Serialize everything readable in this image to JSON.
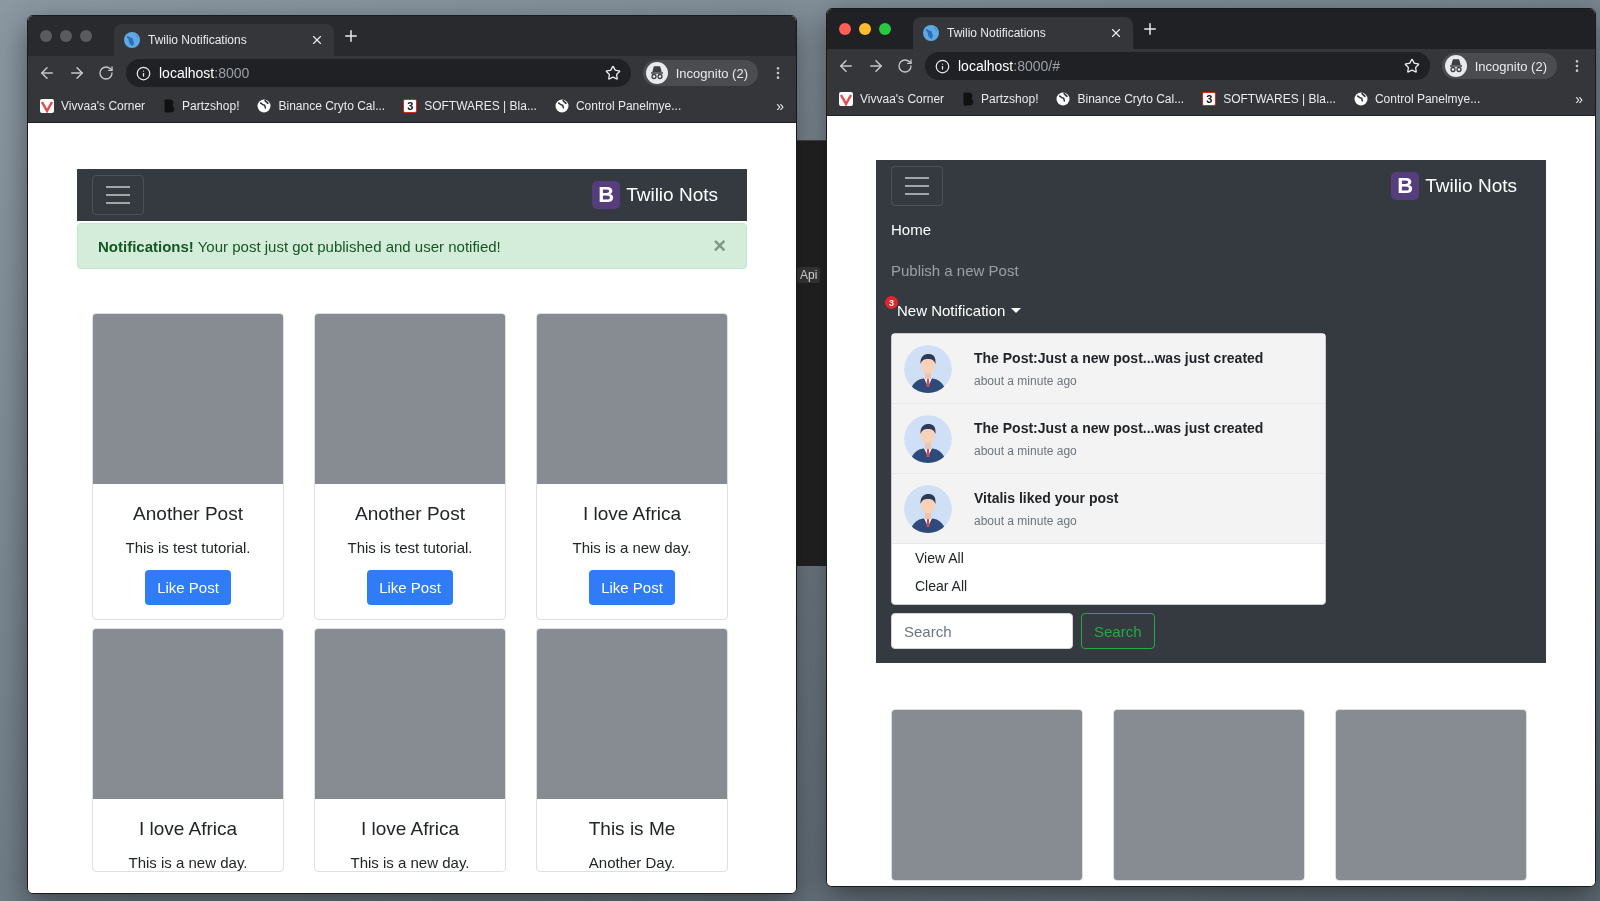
{
  "background_window": {
    "label": "Api"
  },
  "windows": [
    {
      "active": false,
      "tab": {
        "title": "Twilio Notifications",
        "selected": true
      },
      "address": {
        "host": "localhost",
        "path": ":8000"
      },
      "profile": "Incognito (2)",
      "bookmarks": [
        {
          "kind": "vivaldi",
          "label": "Vivvaa's Corner"
        },
        {
          "kind": "bitcoin",
          "label": "Partzshop!"
        },
        {
          "kind": "globe",
          "label": "Binance Cryto Cal..."
        },
        {
          "kind": "number",
          "label": "SOFTWARES | Bla...",
          "mark": "3"
        },
        {
          "kind": "globe",
          "label": "Control Panelmye..."
        }
      ],
      "more": "»",
      "page": {
        "brand": "Twilio Nots",
        "brand_letter": "B",
        "alert": {
          "text": "**Notifications!** Your post just got published and user notified!",
          "close": "×"
        },
        "cards": [
          {
            "kind": "post",
            "title": "Another Post",
            "text": "This is test tutorial.",
            "button": "Like Post"
          },
          {
            "kind": "post",
            "title": "Another Post",
            "text": "This is test tutorial.",
            "button": "Like Post"
          },
          {
            "kind": "post",
            "title": "I love Africa",
            "text": "This is a new day.",
            "button": "Like Post"
          },
          {
            "kind": "post",
            "title": "I love Africa",
            "text": "This is a new day."
          },
          {
            "kind": "post",
            "title": "I love Africa",
            "text": "This is a new day."
          },
          {
            "kind": "post",
            "title": "This is Me",
            "text": "Another Day."
          }
        ]
      }
    },
    {
      "active": true,
      "tab": {
        "title": "Twilio Notifications",
        "selected": true
      },
      "address": {
        "host": "localhost",
        "path": ":8000/#"
      },
      "profile": "Incognito (2)",
      "bookmarks": [
        {
          "kind": "vivaldi",
          "label": "Vivvaa's Corner"
        },
        {
          "kind": "bitcoin",
          "label": "Partzshop!"
        },
        {
          "kind": "globe",
          "label": "Binance Cryto Cal..."
        },
        {
          "kind": "number",
          "label": "SOFTWARES | Bla...",
          "mark": "3"
        },
        {
          "kind": "globe",
          "label": "Control Panelmye..."
        }
      ],
      "more": "»",
      "page": {
        "brand": "Twilio Nots",
        "brand_letter": "B",
        "links": [
          {
            "label": "Home",
            "active": true
          },
          {
            "label": "Publish a new Post",
            "active": false
          }
        ],
        "notifications": {
          "label": "New Notification",
          "count": "3",
          "expanded": true,
          "items": [
            {
              "title": "The Post:Just a new post...was just created",
              "time": "about a minute ago"
            },
            {
              "title": "The Post:Just a new post...was just created",
              "time": "about a minute ago"
            },
            {
              "title": "Vitalis liked your post",
              "time": "about a minute ago"
            }
          ],
          "actions": [
            "View All",
            "Clear All"
          ]
        },
        "search": {
          "placeholder": "Search",
          "button": "Search"
        },
        "cards": [
          {
            "kind": "image_only"
          },
          {
            "kind": "image_only"
          },
          {
            "kind": "image_only"
          }
        ]
      }
    }
  ]
}
